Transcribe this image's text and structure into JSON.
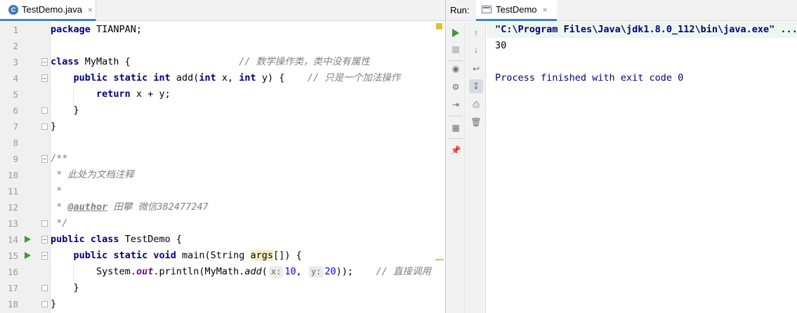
{
  "editor": {
    "tab": {
      "label": "TestDemo.java",
      "icon": "java-class-icon",
      "icon_letter": "C",
      "close": "×"
    },
    "lines": [
      {
        "n": "1",
        "src": "package TIANPAN;"
      },
      {
        "n": "2",
        "src": ""
      },
      {
        "n": "3",
        "src": "class MyMath {                   // 数学操作类，类中没有属性"
      },
      {
        "n": "4",
        "src": "    public static int add(int x, int y) {    // 只是一个加法操作"
      },
      {
        "n": "5",
        "src": "        return x + y;"
      },
      {
        "n": "6",
        "src": "    }"
      },
      {
        "n": "7",
        "src": "}"
      },
      {
        "n": "8",
        "src": ""
      },
      {
        "n": "9",
        "src": "/**"
      },
      {
        "n": "10",
        "src": " * 此处为文档注释"
      },
      {
        "n": "11",
        "src": " *"
      },
      {
        "n": "12",
        "src": " * @author 田攀 微信382477247"
      },
      {
        "n": "13",
        "src": " */"
      },
      {
        "n": "14",
        "src": "public class TestDemo {"
      },
      {
        "n": "15",
        "src": "    public static void main(String args[]) {"
      },
      {
        "n": "16",
        "src": "        System.out.println(MyMath.add( x: 10,  y: 20));    // 直接调用"
      },
      {
        "n": "17",
        "src": "    }"
      },
      {
        "n": "18",
        "src": "}"
      }
    ],
    "tokens": {
      "package": "package",
      "pkg_name": " TIANPAN;",
      "class": "class",
      "mymath_decl": " MyMath {",
      "comment_class": "// 数学操作类，类中没有属性",
      "public": "public",
      "static": "static",
      "int": "int",
      "add_sig_1": " add(",
      "add_sig_x": " x, ",
      "add_sig_y": " y) {",
      "comment_add": "// 只是一个加法操作",
      "return": "return",
      "return_expr": " x + y;",
      "close_brace": "}",
      "doc_open": "/**",
      "doc_line": " * 此处为文档注释",
      "doc_star": " *",
      "doc_star_prefix": " * ",
      "doc_author_tag": "@author",
      "doc_author_text": " 田攀 微信382477247",
      "doc_close": " */",
      "testdemo_decl": " TestDemo {",
      "void": "void",
      "main_sig_1": " main(String ",
      "args": "args",
      "main_sig_2": "[]) {",
      "system": "System.",
      "out": "out",
      "println": ".println(MyMath.",
      "add_call": "add",
      "paren_open": "(",
      "hint_x": "x:",
      "num_10": "10",
      "comma": ",",
      "hint_y": "y:",
      "num_20": "20",
      "paren_close": "));",
      "comment_call": "// 直接调用"
    }
  },
  "run": {
    "title": "Run:",
    "tab_label": "TestDemo",
    "tab_close": "×",
    "toolbar_left": [
      "rerun-icon",
      "stop-icon",
      "camera-icon",
      "bug-settings-icon",
      "exit-icon",
      "layout-icon",
      "pin-icon"
    ],
    "toolbar_right": [
      "up-arrow-icon",
      "down-arrow-icon",
      "soft-wrap-icon",
      "scroll-to-end-icon",
      "print-icon",
      "trash-icon"
    ],
    "console": {
      "command": "\"C:\\Program Files\\Java\\jdk1.8.0_112\\bin\\java.exe\" ...",
      "output": "30",
      "exit": "Process finished with exit code 0"
    }
  },
  "colors": {
    "keyword": "#000080",
    "comment": "#808080",
    "number": "#0000ff",
    "run_green": "#3c9a3c",
    "tab_underline": "#4083c9"
  }
}
